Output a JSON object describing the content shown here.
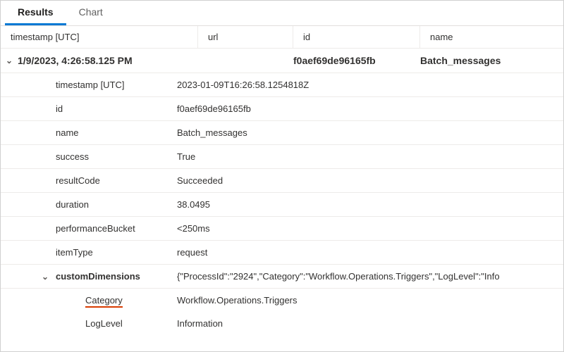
{
  "tabs": {
    "results": "Results",
    "chart": "Chart"
  },
  "columns": {
    "timestamp": "timestamp [UTC]",
    "url": "url",
    "id": "id",
    "name": "name"
  },
  "summary": {
    "timestamp": "1/9/2023, 4:26:58.125 PM",
    "url": "",
    "id": "f0aef69de96165fb",
    "name": "Batch_messages"
  },
  "details": {
    "timestamp_label": "timestamp [UTC]",
    "timestamp_value": "2023-01-09T16:26:58.1254818Z",
    "id_label": "id",
    "id_value": "f0aef69de96165fb",
    "name_label": "name",
    "name_value": "Batch_messages",
    "success_label": "success",
    "success_value": "True",
    "resultCode_label": "resultCode",
    "resultCode_value": "Succeeded",
    "duration_label": "duration",
    "duration_value": "38.0495",
    "performanceBucket_label": "performanceBucket",
    "performanceBucket_value": "<250ms",
    "itemType_label": "itemType",
    "itemType_value": "request",
    "customDimensions_label": "customDimensions",
    "customDimensions_value": "{\"ProcessId\":\"2924\",\"Category\":\"Workflow.Operations.Triggers\",\"LogLevel\":\"Info",
    "category_label": "Category",
    "category_value": "Workflow.Operations.Triggers",
    "loglevel_label": "LogLevel",
    "loglevel_value": "Information"
  }
}
